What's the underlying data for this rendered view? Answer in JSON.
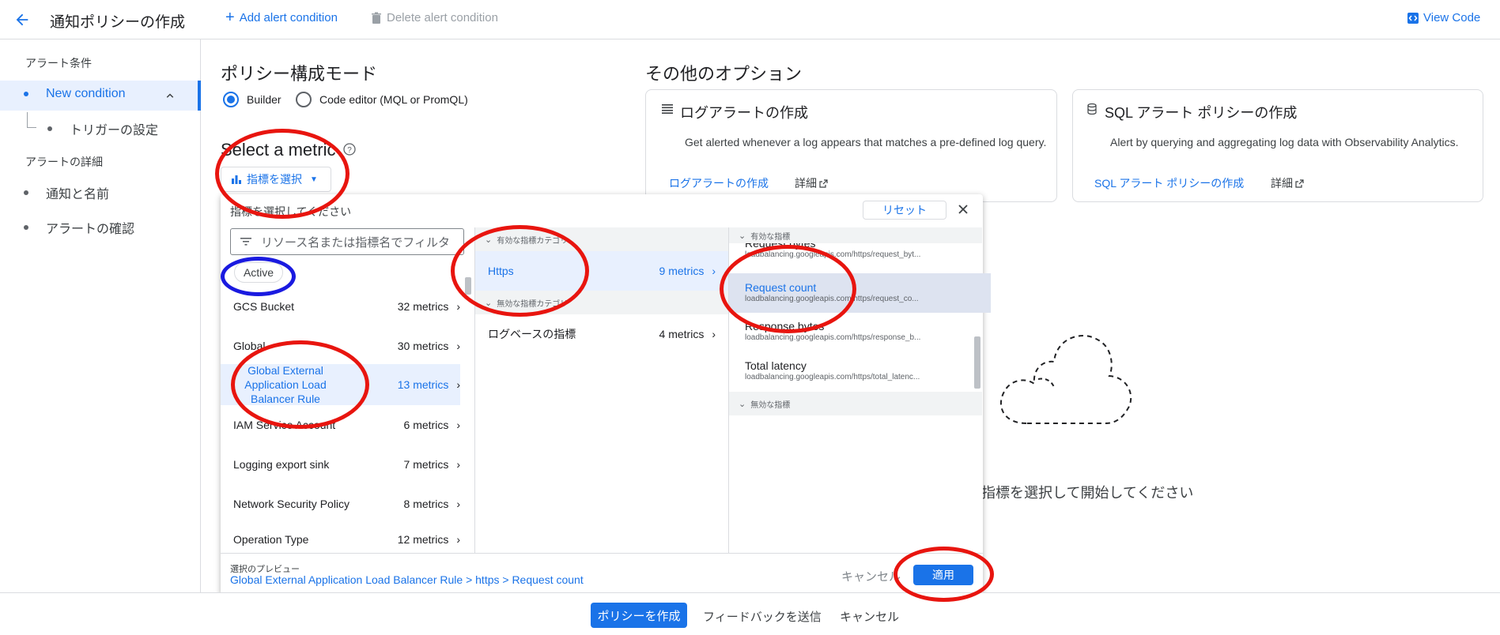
{
  "topbar": {
    "title": "通知ポリシーの作成",
    "add_condition": "Add alert condition",
    "delete_condition": "Delete alert condition",
    "view_code": "View Code"
  },
  "sidebar": {
    "section1": "アラート条件",
    "new_condition": "New condition",
    "trigger": "トリガーの設定",
    "section2": "アラートの詳細",
    "notify": "通知と名前",
    "review": "アラートの確認"
  },
  "main": {
    "mode_title": "ポリシー構成モード",
    "builder": "Builder",
    "code_editor": "Code editor (MQL or PromQL)",
    "select_metric": "Select a metric",
    "select_metric_button": "指標を選択",
    "other_options": "その他のオプション",
    "empty_state": "指標を選択して開始してください"
  },
  "cards": {
    "log": {
      "title": "ログアラートの作成",
      "desc": "Get alerted whenever a log appears that matches a pre-defined log query.",
      "link": "ログアラートの作成",
      "details": "詳細"
    },
    "sql": {
      "title": "SQL アラート ポリシーの作成",
      "desc": "Alert by querying and aggregating log data with Observability Analytics.",
      "link": "SQL アラート ポリシーの作成",
      "details": "詳細"
    }
  },
  "picker": {
    "prompt": "指標を選択してください",
    "reset": "リセット",
    "filter_placeholder": "リソース名または指標名でフィルタ",
    "active_chip": "Active",
    "resources": [
      {
        "name": "GCS Bucket",
        "count": "32 metrics"
      },
      {
        "name": "Global",
        "count": "30 metrics"
      },
      {
        "name": "Global External Application Load Balancer Rule",
        "count": "13 metrics"
      },
      {
        "name": "IAM Service Account",
        "count": "6 metrics"
      },
      {
        "name": "Logging export sink",
        "count": "7 metrics"
      },
      {
        "name": "Network Security Policy",
        "count": "8 metrics"
      },
      {
        "name": "Operation Type",
        "count": "12 metrics"
      }
    ],
    "active_categories_header": "有効な指標カテゴリ",
    "inactive_categories_header": "無効な指標カテゴリ",
    "categories": [
      {
        "name": "Https",
        "count": "9 metrics"
      },
      {
        "name": "ログベースの指標",
        "count": "4 metrics"
      }
    ],
    "active_metrics_header": "有効な指標",
    "inactive_metrics_header": "無効な指標",
    "metrics": [
      {
        "name": "Request bytes",
        "path": "loadbalancing.googleapis.com/https/request_byt..."
      },
      {
        "name": "Request count",
        "path": "loadbalancing.googleapis.com/https/request_co..."
      },
      {
        "name": "Response bytes",
        "path": "loadbalancing.googleapis.com/https/response_b..."
      },
      {
        "name": "Total latency",
        "path": "loadbalancing.googleapis.com/https/total_latenc..."
      }
    ],
    "preview_label": "選択のプレビュー",
    "preview_value": "Global External Application Load Balancer Rule > https > Request count",
    "cancel": "キャンセル",
    "apply": "適用"
  },
  "bottombar": {
    "create": "ポリシーを作成",
    "feedback": "フィードバックを送信",
    "cancel": "キャンセル"
  },
  "colors": {
    "accent": "#1a73e8",
    "annotation_red": "#e8150f",
    "annotation_blue": "#1a1ae0"
  }
}
